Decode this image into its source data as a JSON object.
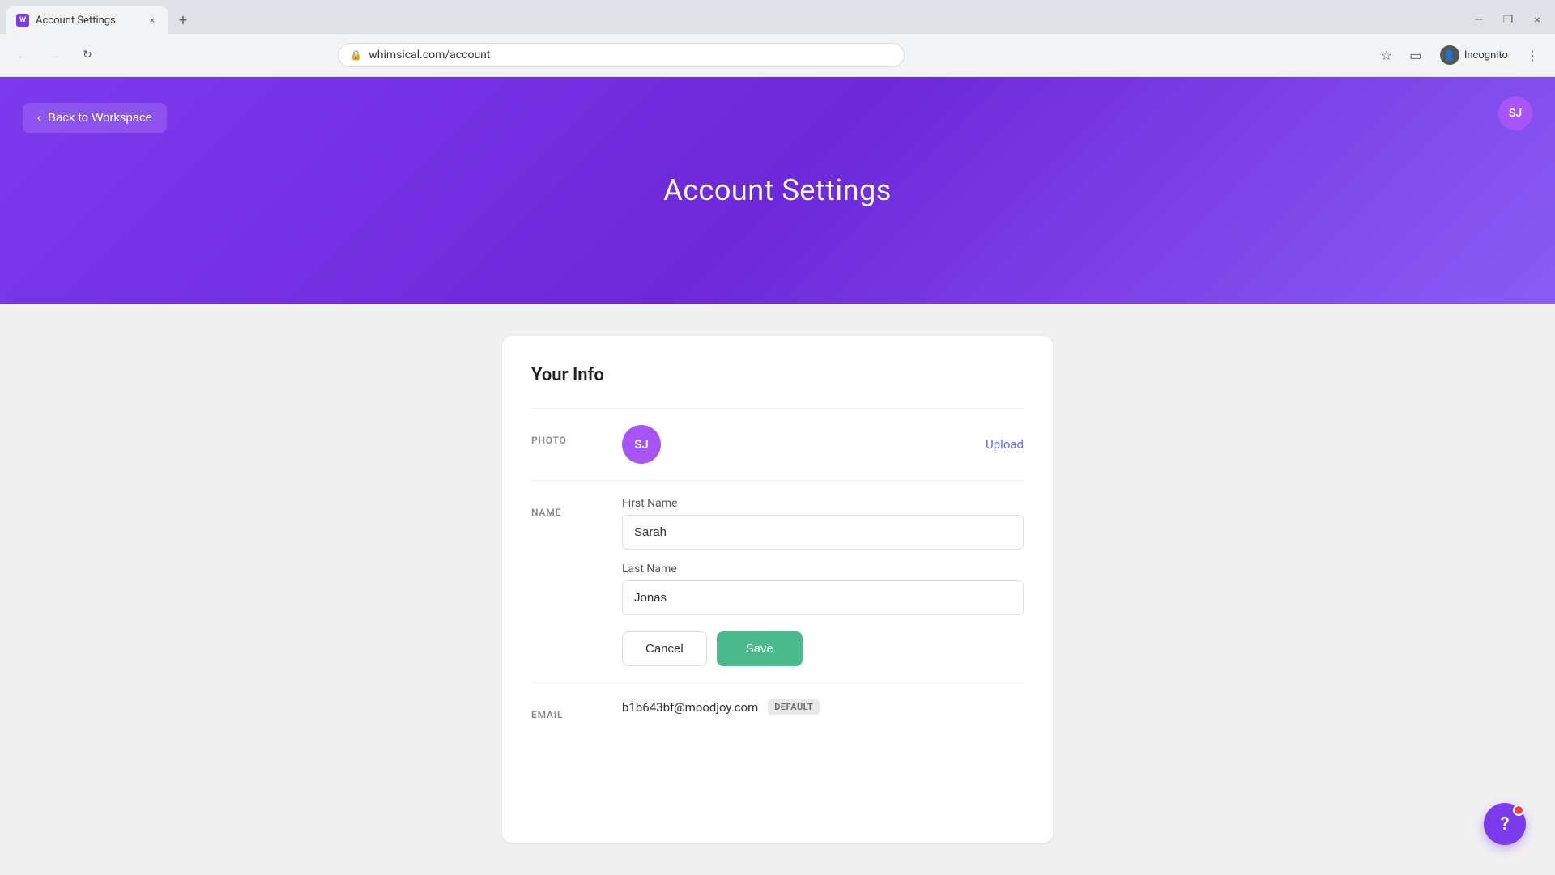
{
  "browser": {
    "tab": {
      "favicon_text": "W",
      "title": "Account Settings",
      "close_icon": "×"
    },
    "tab_new_icon": "+",
    "window_controls": {
      "minimize": "—",
      "maximize": "❐",
      "close": "×"
    },
    "nav": {
      "back_icon": "←",
      "forward_icon": "→",
      "reload_icon": "↻",
      "address": "whimsical.com/account",
      "bookmark_icon": "☆",
      "profile_icon": "👤",
      "incognito_label": "Incognito",
      "menu_icon": "⋮",
      "lock_icon": "🔒"
    }
  },
  "header": {
    "back_label": "Back to Workspace",
    "title": "Account Settings",
    "avatar_initials": "SJ"
  },
  "form": {
    "section_title": "Your Info",
    "photo_label": "PHOTO",
    "photo_initials": "SJ",
    "upload_label": "Upload",
    "name_label": "NAME",
    "first_name_label": "First Name",
    "first_name_value": "Sarah",
    "last_name_label": "Last Name",
    "last_name_value": "Jonas",
    "cancel_label": "Cancel",
    "save_label": "Save",
    "email_label": "EMAIL",
    "email_value": "b1b643bf@moodjoy.com",
    "default_badge": "DEFAULT"
  },
  "help": {
    "icon": "?"
  }
}
